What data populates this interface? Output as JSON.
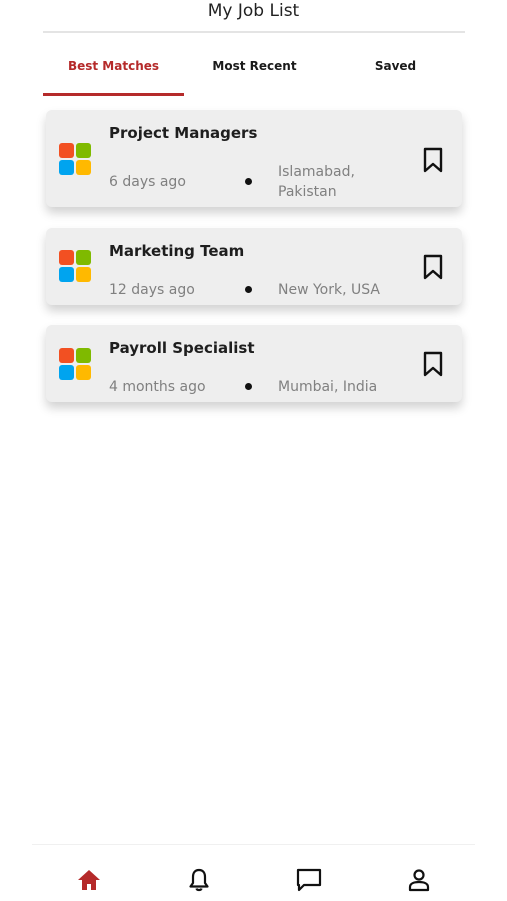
{
  "header": {
    "title": "My Job List"
  },
  "tabs": [
    {
      "label": "Best Matches",
      "active": true
    },
    {
      "label": "Most Recent",
      "active": false
    },
    {
      "label": "Saved",
      "active": false
    }
  ],
  "jobs": [
    {
      "title": "Project Managers",
      "posted": "6 days ago",
      "location": "Islamabad, Pakistan",
      "icon": "company-logo-icon",
      "bookmark_icon": "bookmark-icon"
    },
    {
      "title": "Marketing Team",
      "posted": "12 days ago",
      "location": "New York, USA",
      "icon": "company-logo-icon",
      "bookmark_icon": "bookmark-icon"
    },
    {
      "title": "Payroll Specialist",
      "posted": "4 months ago",
      "location": "Mumbai, India",
      "icon": "company-logo-icon",
      "bookmark_icon": "bookmark-icon"
    }
  ],
  "bottom_nav": [
    {
      "icon": "home-icon",
      "active": true
    },
    {
      "icon": "bell-icon",
      "active": false
    },
    {
      "icon": "chat-icon",
      "active": false
    },
    {
      "icon": "profile-icon",
      "active": false
    }
  ],
  "colors": {
    "accent": "#b52a2a",
    "card_bg": "#eeeeee",
    "logo": [
      "#f25022",
      "#7fba00",
      "#00a4ef",
      "#ffb900"
    ]
  }
}
